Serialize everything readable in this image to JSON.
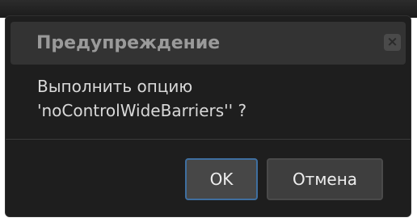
{
  "dialog": {
    "title": "Предупреждение",
    "close_label": "×",
    "message_line1": "Выполнить опцию",
    "message_line2": "'noControlWideBarriers'' ?",
    "ok_label": "OK",
    "cancel_label": "Отмена"
  },
  "colors": {
    "dialog_bg": "#1e1e1e",
    "titlebar_bg": "#333333",
    "title_text": "#9a9a9a",
    "message_text": "#d9d9d9",
    "ok_border": "#3f6fa0",
    "button_bg": "#474747"
  },
  "icons": {
    "close": "close-icon"
  }
}
